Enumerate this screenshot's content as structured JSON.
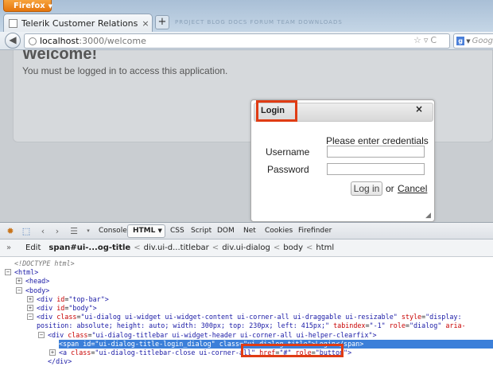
{
  "browser": {
    "menu_button": "Firefox",
    "tab_title": "Telerik Customer Relations Managemen...",
    "tab_close": "×",
    "new_tab": "+",
    "url_host": "localhost",
    "url_path": ":3000/welcome",
    "search_engine": "Goog",
    "ghost_tabs": "PROJECT  BLOG  DOCS  FORUM  TEAM  DOWNLOADS"
  },
  "page": {
    "title": "Welcome!",
    "message": "You must be logged in to access this application."
  },
  "dialog": {
    "title": "Login",
    "close": "×",
    "prompt": "Please enter credentials",
    "username_label": "Username",
    "password_label": "Password",
    "username_value": "",
    "password_value": "",
    "login_button": "Log in",
    "or_text": "or",
    "cancel_link": "Cancel",
    "highlight_color": "#e03c14"
  },
  "firebug": {
    "tabs": [
      "Console",
      "HTML",
      "CSS",
      "Script",
      "DOM",
      "Net",
      "Cookies",
      "Firefinder"
    ],
    "edit_button": "Edit",
    "breadcrumbs": [
      "span#ui-...og-title",
      "div.ui-d...titlebar",
      "div.ui-dialog",
      "body",
      "html"
    ],
    "tree": [
      {
        "indent": 0,
        "toggle": "",
        "html": "<span class=\"cm\">&lt;!DOCTYPE html&gt;</span>"
      },
      {
        "indent": 0,
        "toggle": "−",
        "html": "<span class=\"tg\">&lt;html&gt;</span>"
      },
      {
        "indent": 1,
        "toggle": "+",
        "html": "<span class=\"tg\">&lt;head&gt;</span>"
      },
      {
        "indent": 1,
        "toggle": "−",
        "html": "<span class=\"tg\">&lt;body&gt;</span>"
      },
      {
        "indent": 2,
        "toggle": "+",
        "html": "<span class=\"tg\">&lt;div</span> <span class=\"an\">id</span>=<span class=\"av\">\"top-bar\"</span><span class=\"tg\">&gt;</span>"
      },
      {
        "indent": 2,
        "toggle": "+",
        "html": "<span class=\"tg\">&lt;div</span> <span class=\"an\">id</span>=<span class=\"av\">\"body\"</span><span class=\"tg\">&gt;</span>"
      },
      {
        "indent": 2,
        "toggle": "−",
        "html": "<span class=\"tg\">&lt;div</span> <span class=\"an\">class</span>=<span class=\"av\">\"ui-dialog ui-widget ui-widget-content ui-corner-all ui-draggable ui-resizable\"</span> <span class=\"an\">style</span>=<span class=\"av\">\"display:</span>"
      },
      {
        "indent": 2,
        "toggle": "",
        "html": "<span class=\"av\">position: absolute; height: auto; width: 300px; top: 230px; left: 415px;\"</span> <span class=\"an\">tabindex</span>=<span class=\"av\">\"-1\"</span> <span class=\"an\">role</span>=<span class=\"av\">\"dialog\"</span> <span class=\"an\">aria-</span>"
      },
      {
        "indent": 3,
        "toggle": "−",
        "html": "<span class=\"tg\">&lt;div</span> <span class=\"an\">class</span>=<span class=\"av\">\"ui-dialog-titlebar ui-widget-header ui-corner-all ui-helper-clearfix\"</span><span class=\"tg\">&gt;</span>"
      },
      {
        "indent": 4,
        "toggle": "",
        "sel": true,
        "html": "<span class=\"tg\">&lt;span</span> <span class=\"an\">id</span>=<span class=\"av\">\"ui-dialog-title-login_dialog\"</span> <span class=\"an\">class</span>=<span class=\"av\">\"ui-dialog-title\"</span><span class=\"tg\">&gt;</span>Login<span class=\"tg\">&lt;/span&gt;</span>"
      },
      {
        "indent": 4,
        "toggle": "+",
        "html": "<span class=\"tg\">&lt;a</span> <span class=\"an\">class</span>=<span class=\"av\">\"ui-dialog-titlebar-close ui-corner-all\"</span> <span class=\"an\">href</span>=<span class=\"av\">\"#\"</span> <span class=\"an\">role</span>=<span class=\"av\">\"button\"</span><span class=\"tg\">&gt;</span>"
      },
      {
        "indent": 3,
        "toggle": "",
        "html": "<span class=\"tg\">&lt;/div&gt;</span>"
      }
    ]
  }
}
